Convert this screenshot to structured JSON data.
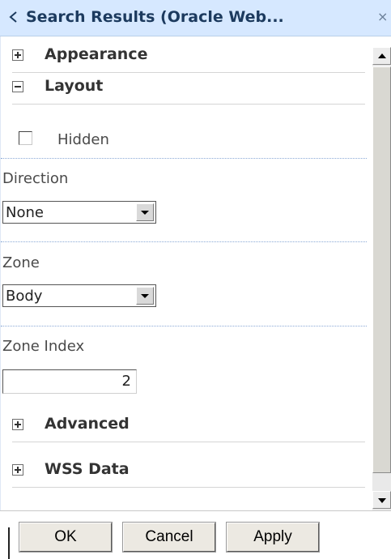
{
  "window": {
    "title": "Search Results (Oracle Web...",
    "back_icon": "collapse-left-icon",
    "close_icon": "close-icon"
  },
  "sections": {
    "appearance": {
      "label": "Appearance",
      "expanded": false
    },
    "layout": {
      "label": "Layout",
      "expanded": true
    },
    "advanced": {
      "label": "Advanced",
      "expanded": false
    },
    "wss_data": {
      "label": "WSS Data",
      "expanded": false
    }
  },
  "layout": {
    "hidden": {
      "label": "Hidden",
      "checked": false
    },
    "direction": {
      "label": "Direction",
      "value": "None"
    },
    "zone": {
      "label": "Zone",
      "value": "Body"
    },
    "zone_index": {
      "label": "Zone Index",
      "value": "2"
    }
  },
  "footer": {
    "ok_label": "OK",
    "cancel_label": "Cancel",
    "apply_label": "Apply"
  },
  "colors": {
    "titlebar_bg": "#d6e8ff",
    "title_text": "#1c3a5e",
    "dotted_divider": "#8aa9d6"
  }
}
